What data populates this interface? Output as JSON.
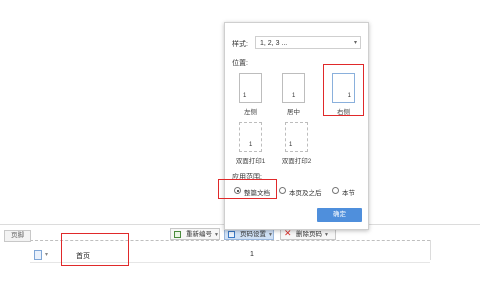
{
  "dialog": {
    "style_label": "样式:",
    "style_value": "1, 2, 3 ...",
    "position_label": "位置:",
    "positions": [
      {
        "label": "左侧",
        "page_number": "1"
      },
      {
        "label": "居中",
        "page_number": "1"
      },
      {
        "label": "右侧",
        "page_number": "1"
      },
      {
        "label": "双面打印1",
        "page_number": "1"
      },
      {
        "label": "双面打印2",
        "page_number": "1"
      }
    ],
    "scope_label": "应用范围:",
    "scopes": [
      "整篇文档",
      "本页及之后",
      "本节"
    ],
    "selected_scope": "整篇文档",
    "ok_label": "确定"
  },
  "footer_bar": {
    "footer_tab": "页脚",
    "renumber_label": "重新编号",
    "page_number_settings_label": "页码设置",
    "delete_page_number_label": "删除页码",
    "home_page_label": "首页",
    "page_number_value": "1"
  },
  "colors": {
    "highlight": "#e0292a",
    "accent": "#4f8fdc"
  }
}
